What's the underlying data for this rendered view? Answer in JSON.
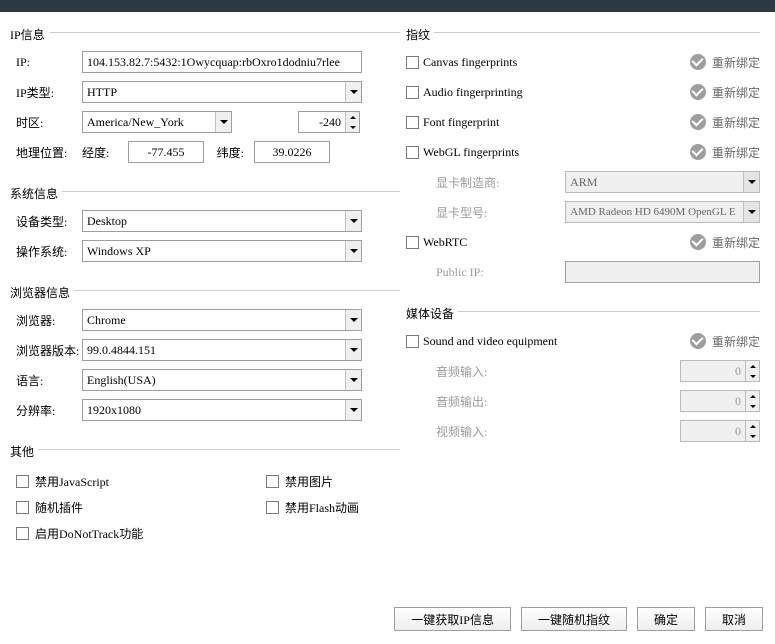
{
  "sections": {
    "ip_info": "IP信息",
    "sys_info": "系统信息",
    "browser_info": "浏览器信息",
    "other": "其他",
    "fingerprint": "指纹",
    "media": "媒体设备"
  },
  "ip": {
    "ip_label": "IP:",
    "ip_value": "104.153.82.7:5432:1Owycquap:rbOxro1dodniu7rlee",
    "type_label": "IP类型:",
    "type_value": "HTTP",
    "timezone_label": "时区:",
    "timezone_value": "America/New_York",
    "tz_offset": "-240",
    "geo_label": "地理位置:",
    "lng_label": "经度:",
    "lng_value": "-77.455",
    "lat_label": "纬度:",
    "lat_value": "39.0226"
  },
  "sys": {
    "device_label": "设备类型:",
    "device_value": "Desktop",
    "os_label": "操作系统:",
    "os_value": "Windows XP"
  },
  "browser": {
    "browser_label": "浏览器:",
    "browser_value": "Chrome",
    "version_label": "浏览器版本:",
    "version_value": "99.0.4844.151",
    "lang_label": "语言:",
    "lang_value": "English(USA)",
    "res_label": "分辨率:",
    "res_value": "1920x1080"
  },
  "other": {
    "disable_js": "禁用JavaScript",
    "random_plugin": "随机插件",
    "dnt": "启用DoNotTrack功能",
    "disable_img": "禁用图片",
    "disable_flash": "禁用Flash动画"
  },
  "fp": {
    "canvas": "Canvas fingerprints",
    "audio": "Audio fingerprinting",
    "font": "Font fingerprint",
    "webgl": "WebGL fingerprints",
    "gpu_vendor_label": "显卡制造商:",
    "gpu_vendor_value": "ARM",
    "gpu_model_label": "显卡型号:",
    "gpu_model_value": "AMD Radeon HD 6490M OpenGL E",
    "webrtc": "WebRTC",
    "public_ip_label": "Public IP:",
    "public_ip_value": "",
    "rebind": "重新绑定"
  },
  "media": {
    "sound_video": "Sound and video equipment",
    "audio_in_label": "音频输入:",
    "audio_out_label": "音频输出:",
    "video_in_label": "视频输入:",
    "val": "0",
    "rebind": "重新绑定"
  },
  "footer": {
    "fetch_ip": "一键获取IP信息",
    "random_fp": "一键随机指纹",
    "ok": "确定",
    "cancel": "取消"
  }
}
